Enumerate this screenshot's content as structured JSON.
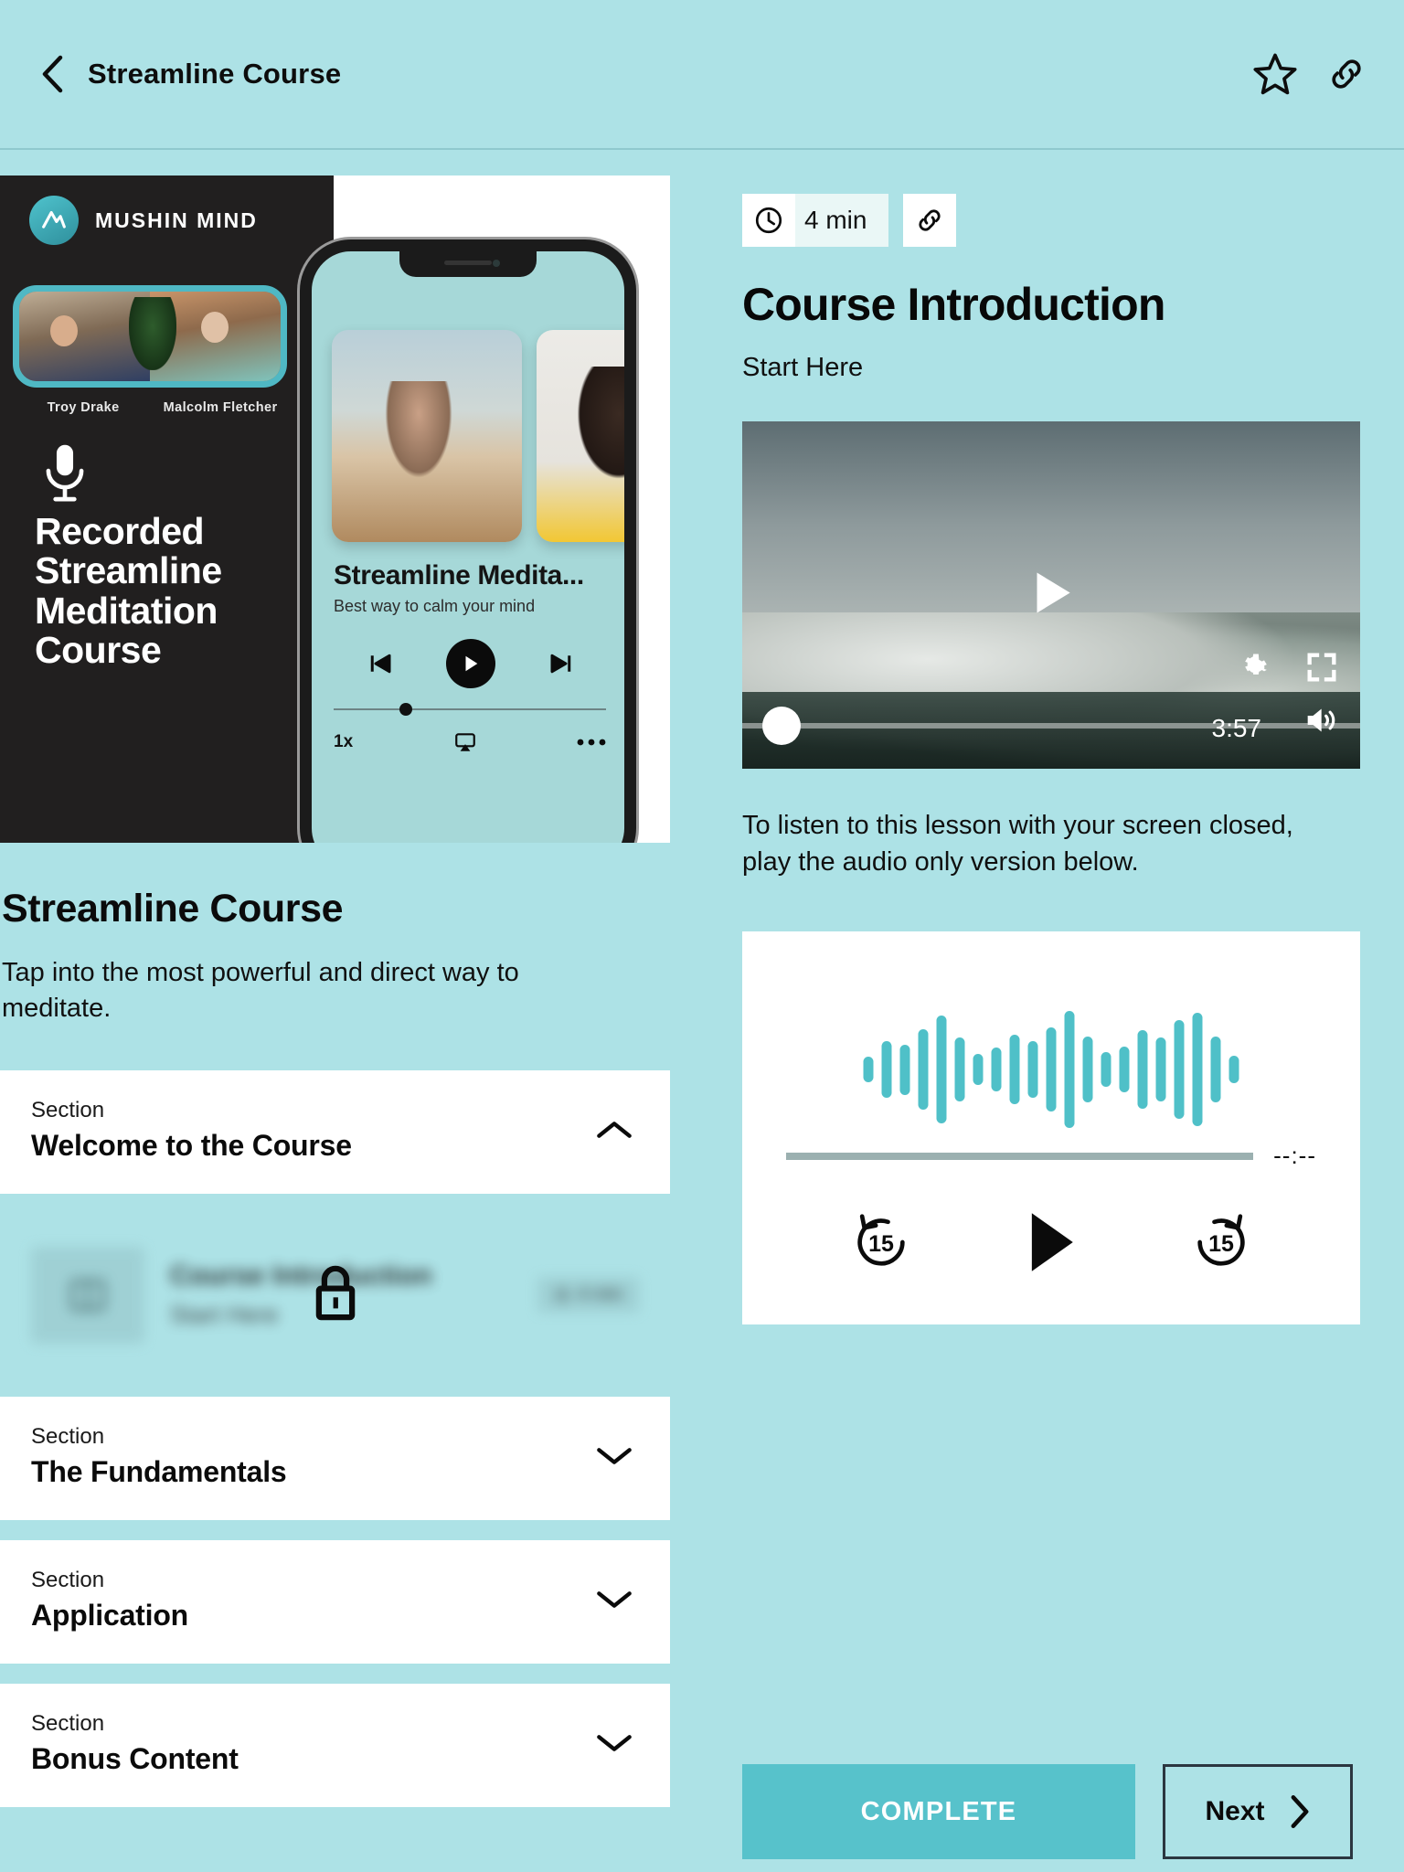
{
  "header": {
    "back_icon": "chevron-left-icon",
    "title": "Streamline Course",
    "star_icon": "star-outline-icon",
    "link_icon": "link-icon"
  },
  "course": {
    "thumbnail": {
      "brand": "MUSHIN MIND",
      "instructors": [
        "Troy Drake",
        "Malcolm Fletcher"
      ],
      "mic_icon": "microphone-icon",
      "headline": "Recorded Streamline Meditation Course",
      "phone_preview": {
        "title": "Streamline Medita...",
        "subtitle": "Best way to calm your mind",
        "prev_icon": "skip-previous-icon",
        "play_icon": "play-icon",
        "next_icon": "skip-next-icon",
        "speed": "1x",
        "cast_icon": "airplay-icon",
        "more_icon": "more-horizontal-icon"
      }
    },
    "title": "Streamline Course",
    "description": "Tap into the most powerful and direct way to meditate."
  },
  "curriculum": {
    "kicker": "Section",
    "sections": [
      {
        "kicker": "Section",
        "name": "Welcome to the Course",
        "expanded": true,
        "chevron": "chevron-up-icon"
      },
      {
        "kicker": "Section",
        "name": "The Fundamentals",
        "expanded": false,
        "chevron": "chevron-down-icon"
      },
      {
        "kicker": "Section",
        "name": "Application",
        "expanded": false,
        "chevron": "chevron-down-icon"
      },
      {
        "kicker": "Section",
        "name": "Bonus Content",
        "expanded": false,
        "chevron": "chevron-down-icon"
      }
    ],
    "locked_lesson": {
      "title": "Course Introduction",
      "subtitle": "Start Here",
      "badge": "4 min",
      "lock_icon": "lock-icon",
      "thumb_icon": "book-icon",
      "locked": true
    }
  },
  "lesson": {
    "duration": "4 min",
    "clock_icon": "clock-icon",
    "link_icon": "link-icon",
    "title": "Course Introduction",
    "subtitle": "Start Here",
    "video": {
      "play_icon": "play-icon",
      "settings_icon": "gear-icon",
      "fullscreen_icon": "fullscreen-icon",
      "volume_icon": "volume-icon",
      "time": "3:57",
      "progress_percent": 0
    },
    "audio_note": "To listen to this lesson with your screen closed, play the audio only version below.",
    "audio_player": {
      "waveform_color": "#4fc0c8",
      "waveform": [
        28,
        62,
        55,
        88,
        118,
        70,
        34,
        48,
        76,
        62,
        92,
        128,
        72,
        38,
        50,
        86,
        70,
        108,
        124,
        72,
        30
      ],
      "time": "--:--",
      "progress_percent": 0,
      "rewind_label": "15",
      "rewind_icon": "replay-15-icon",
      "play_icon": "play-icon",
      "forward_label": "15",
      "forward_icon": "forward-15-icon"
    }
  },
  "footer": {
    "complete_label": "COMPLETE",
    "next_label": "Next",
    "next_icon": "chevron-right-icon"
  },
  "colors": {
    "background": "#ade2e6",
    "accent": "#57c2cb",
    "card": "#ffffff",
    "text": "#0b0b0b"
  }
}
